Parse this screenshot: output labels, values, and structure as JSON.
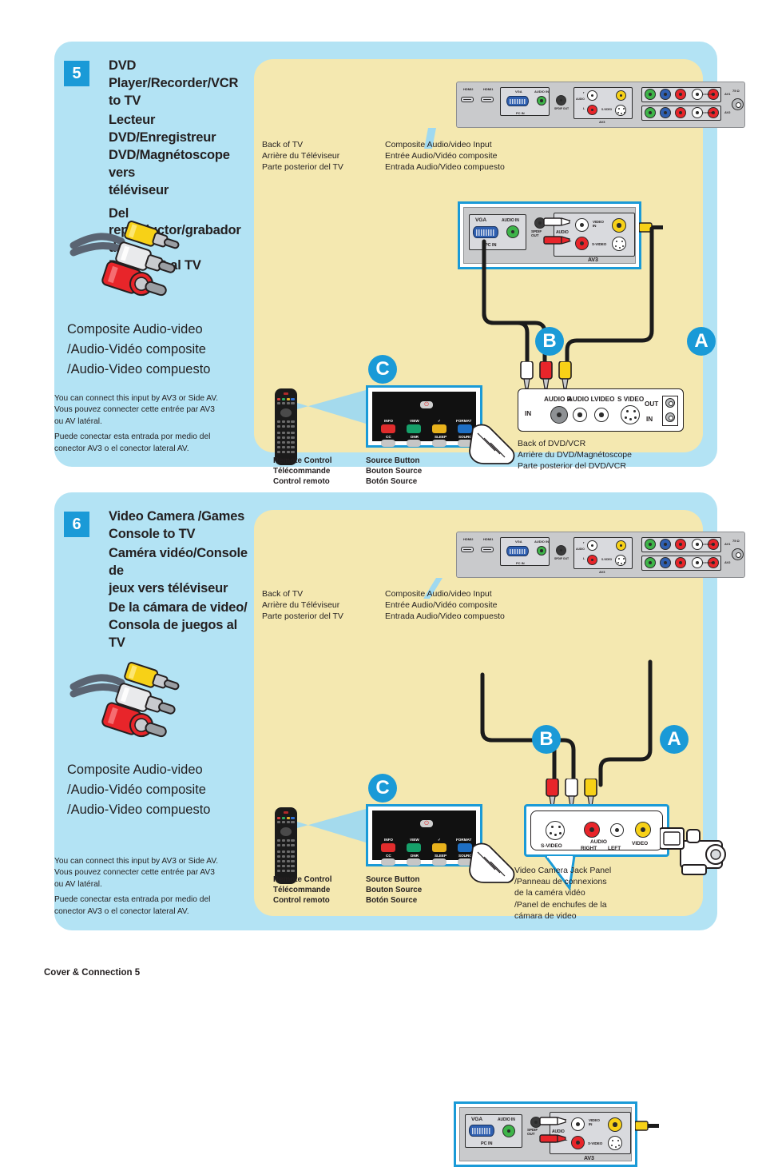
{
  "document": {
    "footer": "Cover & Connection 5"
  },
  "sections": [
    {
      "number": "5",
      "heading": {
        "en_lines": [
          "DVD Player/Recorder/VCR",
          "to TV"
        ],
        "fr_lines": [
          "Lecteur DVD/Enregistreur",
          "DVD/Magnétoscope vers",
          "téléviseur"
        ],
        "es_lines": [
          "Del reproductor/grabador de",
          "DVD/VCR al TV"
        ]
      },
      "composite_caption": [
        "Composite Audio-video",
        "/Audio-Vidéo composite",
        "/Audio-Video compuesto"
      ],
      "note": [
        "You can connect this input by AV3 or Side AV.",
        "Vous pouvez connecter cette entrée par AV3",
        "ou AV latéral.",
        "Puede conectar esta entrada por medio del",
        "conector AV3 o el conector lateral AV."
      ],
      "tv_panel_labels": {
        "hdmi2": "HDMI2",
        "hdmi1": "HDMI1",
        "vga": "VGA",
        "audio_in": "AUDIO IN",
        "pc_in": "PC IN",
        "spdif_out": "SPDIF OUT",
        "audio": "AUDIO",
        "r": "r",
        "l": "L",
        "video_in": "VIDEO IN",
        "s_video": "S-VIDEO",
        "av3": "AV3",
        "av1": "AV1",
        "av2": "AV2",
        "audio_in_short": "AUDIO IN",
        "antenna": "75 Ω"
      },
      "back_of_tv": [
        "Back of TV",
        "Arrière du Téléviseur",
        "Parte posterior del TV"
      ],
      "composite_input": [
        "Composite Audio/video Input",
        "Entrée Audio/Vidéo composite",
        "Entrada Audio/Video compuesto"
      ],
      "markers": [
        "A",
        "B",
        "C"
      ],
      "device_panel": {
        "in": "IN",
        "audio_r": "AUDIO R",
        "audio_l": "AUDIO L",
        "video": "VIDEO",
        "s_video": "S VIDEO",
        "out": "OUT",
        "in2": "IN"
      },
      "device_caption": [
        "Back of DVD/VCR",
        "Arrière du DVD/Magnétoscope",
        "Parte posterior del DVD/VCR"
      ],
      "remote_caption": [
        "Remote Control",
        "Télécommande",
        "Control remoto"
      ],
      "source_caption": [
        "Source Button",
        "Bouton Source",
        "Botón Source"
      ],
      "remote_keys_top": [
        "INFO",
        "VIEW",
        "✓",
        "FORMAT"
      ],
      "remote_keys_bottom": [
        "CC",
        "DNR",
        "SLEEP",
        "SOURCE"
      ]
    },
    {
      "number": "6",
      "heading": {
        "en_lines": [
          "Video Camera /Games",
          "Console to TV"
        ],
        "fr_lines": [
          "Caméra vidéo/Console de",
          "jeux vers téléviseur"
        ],
        "es_lines": [
          "De la cámara de video/",
          "Consola de juegos al TV"
        ]
      },
      "composite_caption": [
        "Composite Audio-video",
        "/Audio-Vidéo composite",
        "/Audio-Video compuesto"
      ],
      "note": [
        "You can connect this input by AV3 or Side AV.",
        "Vous pouvez connecter cette entrée par AV3",
        "ou AV latéral.",
        "Puede conectar esta entrada por medio del",
        "conector AV3 o el conector lateral AV."
      ],
      "tv_panel_labels": {
        "hdmi2": "HDMI2",
        "hdmi1": "HDMI1",
        "vga": "VGA",
        "audio_in": "AUDIO IN",
        "pc_in": "PC IN",
        "spdif_out": "SPDIF OUT",
        "audio": "AUDIO",
        "r": "r",
        "l": "L",
        "video_in": "VIDEO IN",
        "s_video": "S-VIDEO",
        "av3": "AV3",
        "av1": "AV1",
        "av2": "AV2",
        "audio_in_short": "AUDIO IN",
        "antenna": "75 Ω"
      },
      "back_of_tv": [
        "Back of TV",
        "Arrière du Téléviseur",
        "Parte posterior del TV"
      ],
      "composite_input": [
        "Composite Audio/video Input",
        "Entrée Audio/Vidéo composite",
        "Entrada Audio/Video compuesto"
      ],
      "markers": [
        "A",
        "B",
        "C"
      ],
      "device_panel": {
        "s_video": "S-VIDEO",
        "audio": "AUDIO",
        "right": "RIGHT",
        "left": "LEFT",
        "video": "VIDEO"
      },
      "device_caption": [
        "Video Camera Jack Panel",
        "/Panneau de connexions",
        "de la caméra vidéo",
        "/Panel de enchufes de la",
        "cámara de video"
      ],
      "remote_caption": [
        "Remote Control",
        "Télécommande",
        "Control remoto"
      ],
      "source_caption": [
        "Source Button",
        "Bouton Source",
        "Botón Source"
      ],
      "remote_keys_top": [
        "INFO",
        "VIEW",
        "✓",
        "FORMAT"
      ],
      "remote_keys_bottom": [
        "CC",
        "DNR",
        "SLEEP",
        "SOURCE"
      ]
    }
  ],
  "colors": {
    "panel_blue": "#b3e3f4",
    "diagram_yellow": "#f4e8b0",
    "accent_blue": "#1a9ad7",
    "ink": "#231f20",
    "jack_yellow": "#f7d117",
    "jack_red": "#e8252a",
    "jack_white": "#ffffff",
    "jack_green": "#3eb449",
    "jack_blue": "#2f5fb0"
  }
}
